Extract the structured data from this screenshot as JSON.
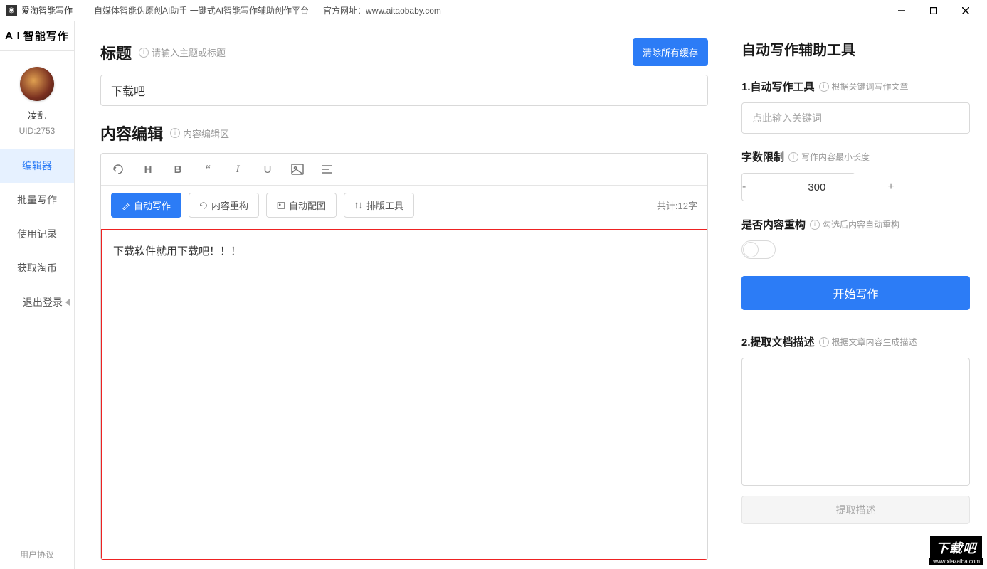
{
  "titlebar": {
    "app_name": "爱淘智能写作",
    "tagline": "自媒体智能伪原创AI助手    一键式AI智能写作辅助创作平台",
    "website_label": "官方网址：",
    "website_url": "www.aitaobaby.com"
  },
  "sidebar": {
    "brand": "智能写作",
    "brand_prefix": "A I",
    "username": "凌乱",
    "uid": "UID:2753",
    "nav": {
      "editor": "编辑器",
      "batch": "批量写作",
      "history": "使用记录",
      "coins": "获取淘币",
      "logout": "退出登录"
    },
    "agreement": "用户协议"
  },
  "editor": {
    "title_label": "标题",
    "title_hint": "请输入主题或标题",
    "clear_cache": "清除所有缓存",
    "title_value": "下载吧",
    "content_label": "内容编辑",
    "content_hint": "内容编辑区",
    "actions": {
      "auto_write": "自动写作",
      "restructure": "内容重构",
      "auto_image": "自动配图",
      "layout_tool": "排版工具"
    },
    "char_count": "共计:12字",
    "content_value": "下载软件就用下载吧！！！"
  },
  "tools": {
    "panel_title": "自动写作辅助工具",
    "auto_write_label": "1.自动写作工具",
    "auto_write_hint": "根据关键词写作文章",
    "keyword_placeholder": "点此输入关键词",
    "word_limit_label": "字数限制",
    "word_limit_hint": "写作内容最小长度",
    "word_limit_value": "300",
    "restructure_label": "是否内容重构",
    "restructure_hint": "勾选后内容自动重构",
    "start_button": "开始写作",
    "extract_label": "2.提取文档描述",
    "extract_hint": "根据文章内容生成描述",
    "extract_button": "提取描述"
  },
  "watermark": {
    "text": "下载吧",
    "url": "www.xiazaiba.com"
  }
}
